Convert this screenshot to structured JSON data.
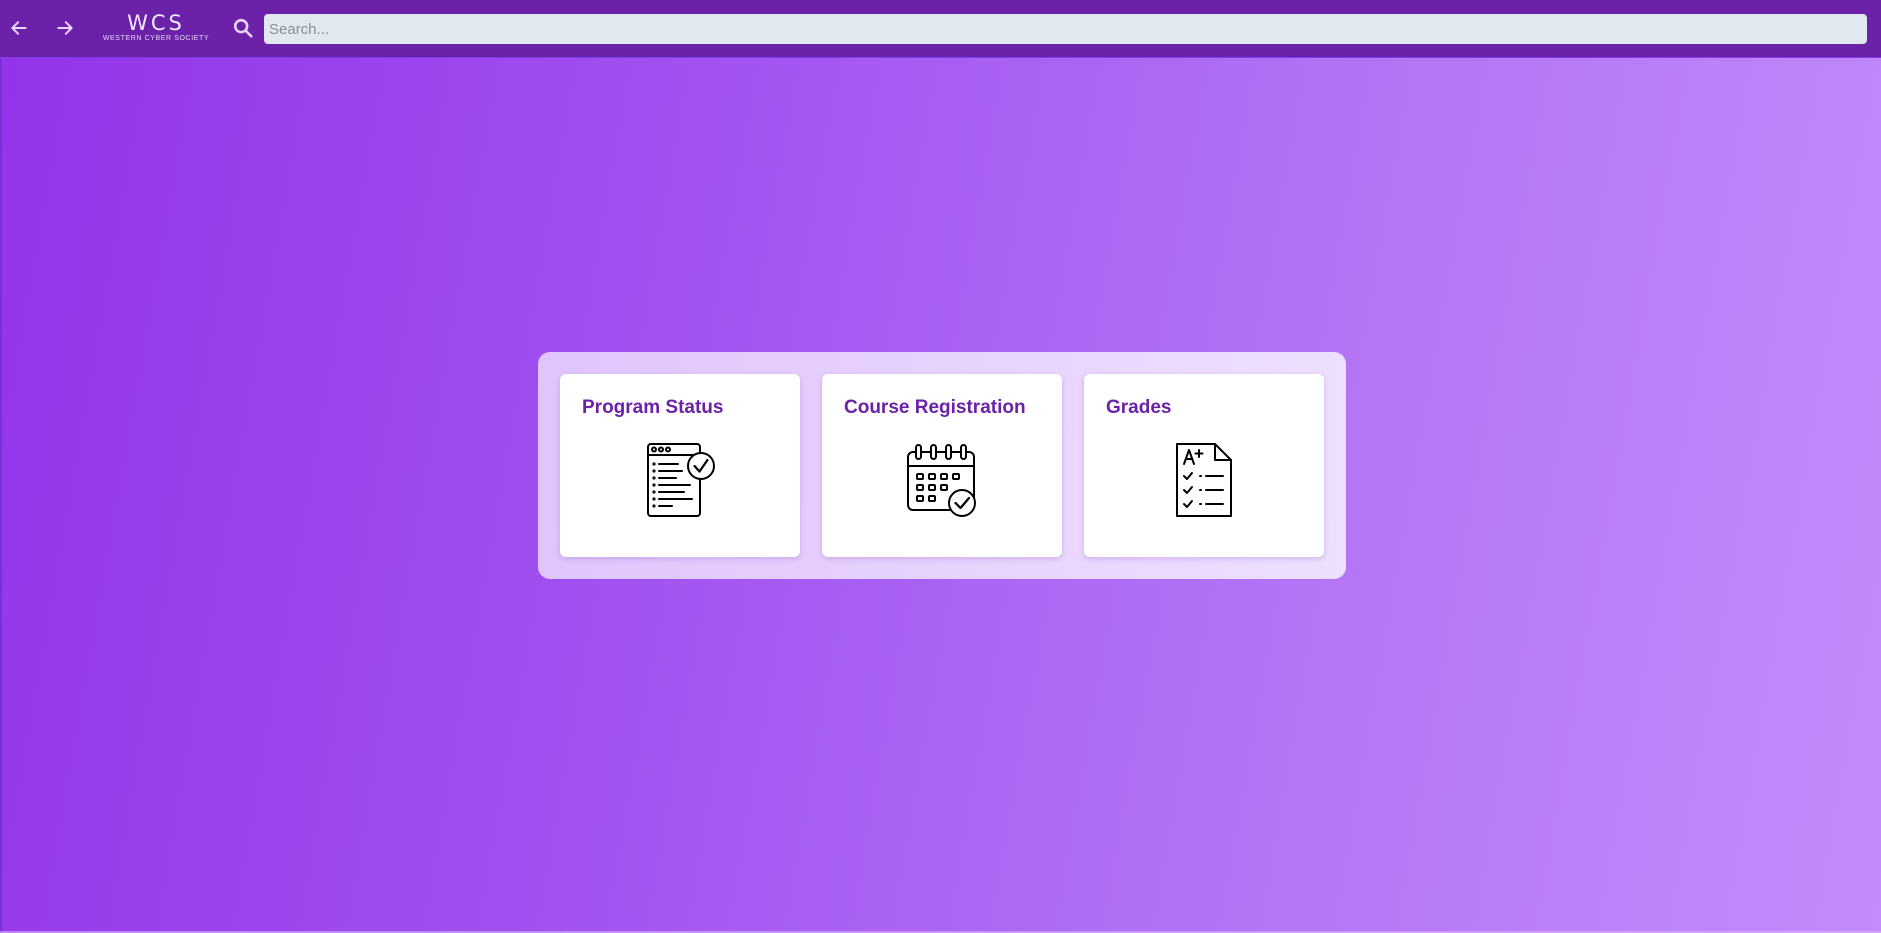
{
  "topbar": {
    "back_icon": "arrow-left-icon",
    "forward_icon": "arrow-right-icon",
    "logo": {
      "mark": "WCS",
      "subtitle": "WESTERN CYBER SOCIETY"
    },
    "search": {
      "icon": "search-icon",
      "placeholder": "Search...",
      "value": ""
    }
  },
  "cards": [
    {
      "title": "Program Status",
      "icon": "program-status-icon"
    },
    {
      "title": "Course Registration",
      "icon": "calendar-check-icon"
    },
    {
      "title": "Grades",
      "icon": "grades-document-icon"
    }
  ],
  "colors": {
    "topbar": "#6b21a8",
    "accent": "#6b21a8",
    "search_bg": "#e2e8f0",
    "gradient_start": "#9234ea",
    "gradient_end": "#c48bfb"
  }
}
